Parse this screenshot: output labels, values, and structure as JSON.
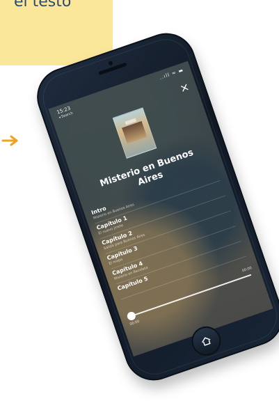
{
  "callout": {
    "text": "el testo"
  },
  "phone": {
    "status": {
      "time": "15:23",
      "back": "◂ Search",
      "icons": "..ıll ≈ ▬"
    },
    "book": {
      "title": "Misterio en Buenos Aires"
    },
    "chapters": [
      {
        "title": "Intro",
        "subtitle": "Misterio en Buenos Aires"
      },
      {
        "title": "Capítulo 1",
        "subtitle": "El nuevo jinete"
      },
      {
        "title": "Capítulo 2",
        "subtitle": "Salida para Buenos Aires"
      },
      {
        "title": "Capítulo 3",
        "subtitle": "El mapa"
      },
      {
        "title": "Capítulo 4",
        "subtitle": "Misterio en Recoleta"
      },
      {
        "title": "Capítulo 5",
        "subtitle": ""
      }
    ],
    "player": {
      "progress": 0,
      "start_time": "00:00",
      "end_time": "00:00"
    },
    "icons": {
      "close": "close-icon",
      "home": "home-icon",
      "arrow": "arrow-icon"
    },
    "colors": {
      "callout_bg": "#fbe79a",
      "arrow": "#f0a31e",
      "phone_body": "#162231"
    }
  }
}
